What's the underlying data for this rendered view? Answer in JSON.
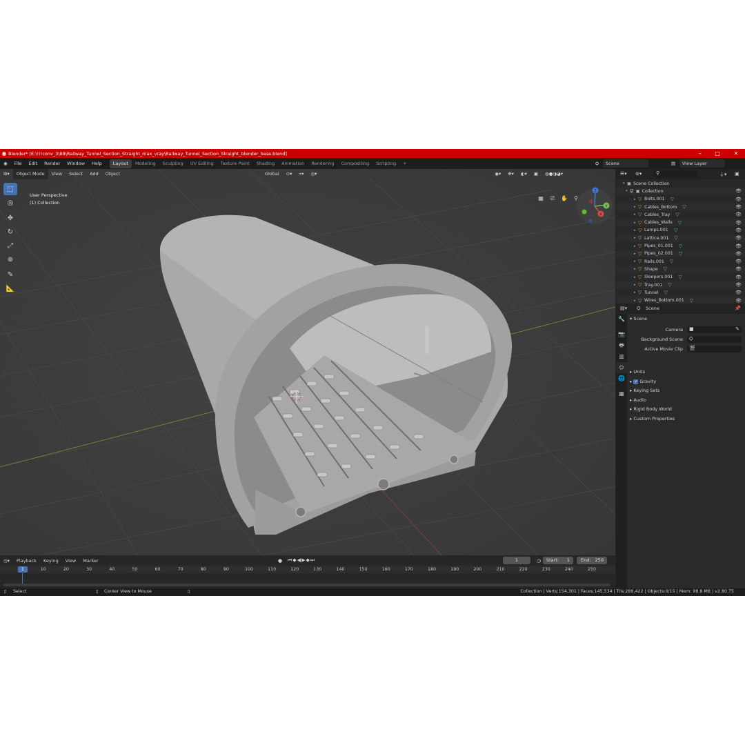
{
  "title_bar": {
    "title": "Blender* [E:\\!!!conv_3\\88\\Railway_Tunnel_Section_Straight_max_vray\\Railway_Tunnel_Section_Straight_blender_base.blend]",
    "minimize": "–",
    "maximize": "□",
    "close": "✕"
  },
  "menu": {
    "items": [
      "File",
      "Edit",
      "Render",
      "Window",
      "Help"
    ],
    "workspaces": [
      "Layout",
      "Modeling",
      "Sculpting",
      "UV Editing",
      "Texture Paint",
      "Shading",
      "Animation",
      "Rendering",
      "Compositing",
      "Scripting"
    ],
    "active_workspace": "Layout",
    "add_tab": "+",
    "scene_field": "Scene",
    "view_layer_field": "View Layer"
  },
  "viewport": {
    "mode": "Object Mode",
    "menus": [
      "View",
      "Select",
      "Add",
      "Object"
    ],
    "transform_orientation": "Global",
    "perspective_label": "User Perspective",
    "collection_label": "(1) Collection",
    "gizmo": {
      "x": "X",
      "y": "Y",
      "z": "Z"
    }
  },
  "outliner": {
    "root": "Scene Collection",
    "collection": "Collection",
    "objects": [
      "Bolts.001",
      "Cables_Bottom",
      "Cables_Tray",
      "Cables_Walls",
      "Lamps.001",
      "Lattice.001",
      "Pipes_01.001",
      "Pipes_02.001",
      "Rails.001",
      "Shape",
      "Sleepers.001",
      "Tray.001",
      "Tunnel",
      "Wires_Bottom.001"
    ]
  },
  "properties": {
    "context": "Scene",
    "panel_title": "Scene",
    "fields": [
      "Camera",
      "Background Scene",
      "Active Movie Clip"
    ],
    "panels": [
      "Units",
      "Gravity",
      "Keying Sets",
      "Audio",
      "Rigid Body World",
      "Custom Properties"
    ],
    "gravity_checked": true
  },
  "timeline": {
    "menus": [
      "Playback",
      "Keying",
      "View",
      "Marker"
    ],
    "current_frame": "1",
    "start_label": "Start:",
    "start": "1",
    "end_label": "End:",
    "end": "250",
    "ticks": [
      "1",
      "10",
      "20",
      "30",
      "40",
      "50",
      "60",
      "70",
      "80",
      "90",
      "100",
      "110",
      "120",
      "130",
      "140",
      "150",
      "160",
      "170",
      "180",
      "190",
      "200",
      "210",
      "220",
      "230",
      "240",
      "250"
    ]
  },
  "status": {
    "left": "Select",
    "middle": "Center View to Mouse",
    "right": "Collection | Verts:154,301 | Faces:145,534 | Tris:289,422 | Objects:0/15 | Mem: 98.8 MB | v2.80.75"
  },
  "colors": {
    "title_bar": "#cc0000",
    "accent": "#4772b3",
    "object_icon": "#e89a3c",
    "mesh_data_icon": "#58c47d"
  }
}
